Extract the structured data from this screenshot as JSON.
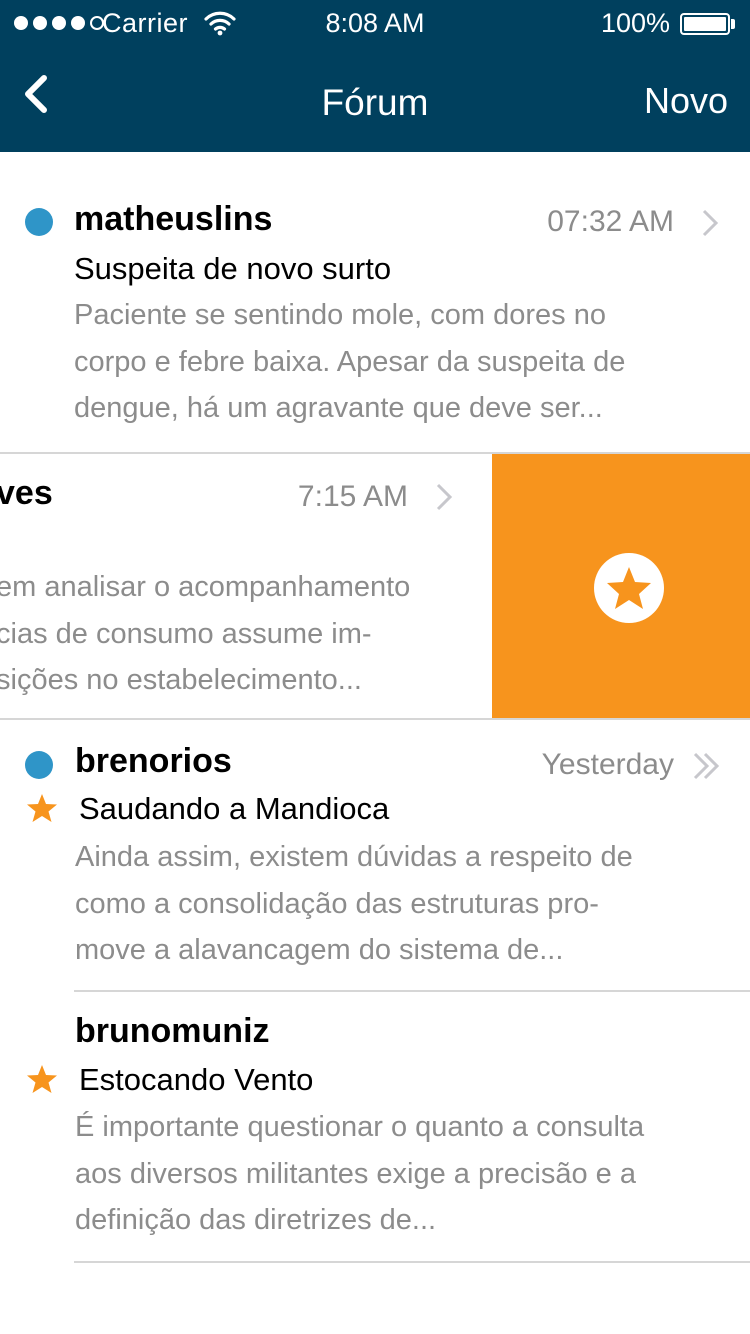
{
  "status_bar": {
    "carrier": "Carrier",
    "time": "8:08 AM",
    "battery": "100%",
    "signal_bars_filled": 4,
    "signal_bars_total": 5
  },
  "nav": {
    "back_icon": "chevron-left-icon",
    "title": "Fórum",
    "new_label": "Novo"
  },
  "colors": {
    "nav_background": "#00405e",
    "unread_dot": "#2f95c8",
    "favorite_orange": "#f7941d",
    "secondary_text": "#8c8c8c"
  },
  "posts": [
    {
      "author": "matheuslins",
      "time": "07:32 AM",
      "subject": "Suspeita de novo surto",
      "preview": [
        "Paciente se sentindo mole, com dores no",
        "corpo e febre baixa. Apesar da suspeita de",
        "dengue, há um agravante que deve ser..."
      ],
      "unread": true,
      "starred": false,
      "indicator": "chevron-right-icon"
    },
    {
      "author_visible": "ves",
      "time": "7:15 AM",
      "preview": [
        "em analisar o acompanhamento",
        "cias de consumo assume im-",
        "sições no estabelecimento..."
      ],
      "swipe_action": "favorite-star-icon",
      "indicator": "chevron-right-icon"
    },
    {
      "author": "brenorios",
      "time": "Yesterday",
      "subject": "Saudando a Mandioca",
      "preview": [
        "Ainda assim, existem dúvidas a respeito de",
        "como a consolidação das estruturas pro-",
        "move a alavancagem do sistema de..."
      ],
      "unread": true,
      "starred": true,
      "indicator": "double-chevron-right-icon"
    },
    {
      "author": "brunomuniz",
      "subject": "Estocando Vento",
      "preview": [
        "É importante questionar o quanto a consulta",
        "aos diversos militantes exige a precisão e a",
        "definição das diretrizes de..."
      ],
      "unread": false,
      "starred": true
    }
  ]
}
